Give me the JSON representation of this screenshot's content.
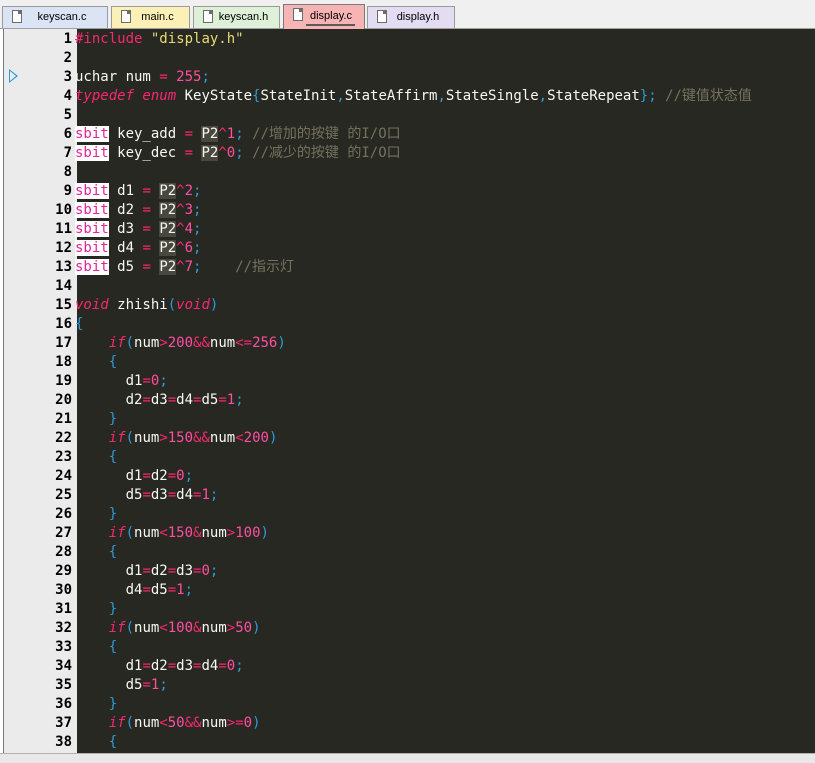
{
  "tabs": [
    {
      "label": "keyscan.c",
      "bg": "#dbe4f5"
    },
    {
      "label": "main.c",
      "bg": "#fbf0b6"
    },
    {
      "label": "keyscan.h",
      "bg": "#dff0d8"
    },
    {
      "label": "display.c",
      "bg": "#f7b4b4",
      "active": true
    },
    {
      "label": "display.h",
      "bg": "#e3dcf3"
    }
  ],
  "gutter": {
    "marker": "current-line-arrow"
  },
  "code_lines": [
    {
      "n": "1",
      "html": "<span class=\"k\">#include</span> <span class=\"s\">\"display.h\"</span>"
    },
    {
      "n": "2",
      "html": ""
    },
    {
      "n": "3",
      "html": "uchar num <span class=\"k\">=</span> <span class=\"n\">255</span><span class=\"p\">;</span>"
    },
    {
      "n": "4",
      "html": "<span class=\"ki\">typedef enum</span> KeyState<span class=\"p\">{</span>StateInit<span class=\"p\">,</span>StateAffirm<span class=\"p\">,</span>StateSingle<span class=\"p\">,</span>StateRepeat<span class=\"p\">};</span> <span class=\"c\">//键值状态值</span>"
    },
    {
      "n": "5",
      "html": ""
    },
    {
      "n": "6",
      "html": "<span class=\"kw\">sbit</span> key_add <span class=\"k\">=</span> <span class=\"hl\">P2</span><span class=\"k\">^</span><span class=\"n\">1</span><span class=\"p\">;</span> <span class=\"c\">//增加的按键 的I/O口</span>"
    },
    {
      "n": "7",
      "html": "<span class=\"kw\">sbit</span> key_dec <span class=\"k\">=</span> <span class=\"hl\">P2</span><span class=\"k\">^</span><span class=\"n\">0</span><span class=\"p\">;</span> <span class=\"c\">//减少的按键 的I/O口</span>"
    },
    {
      "n": "8",
      "html": ""
    },
    {
      "n": "9",
      "html": "<span class=\"kw\">sbit</span> d1 <span class=\"k\">=</span> <span class=\"hl\">P2</span><span class=\"k\">^</span><span class=\"n\">2</span><span class=\"p\">;</span>"
    },
    {
      "n": "10",
      "html": "<span class=\"kw\">sbit</span> d2 <span class=\"k\">=</span> <span class=\"hl\">P2</span><span class=\"k\">^</span><span class=\"n\">3</span><span class=\"p\">;</span>"
    },
    {
      "n": "11",
      "html": "<span class=\"kw\">sbit</span> d3 <span class=\"k\">=</span> <span class=\"hl\">P2</span><span class=\"k\">^</span><span class=\"n\">4</span><span class=\"p\">;</span>"
    },
    {
      "n": "12",
      "html": "<span class=\"kw\">sbit</span> d4 <span class=\"k\">=</span> <span class=\"hl\">P2</span><span class=\"k\">^</span><span class=\"n\">6</span><span class=\"p\">;</span>"
    },
    {
      "n": "13",
      "html": "<span class=\"kw\">sbit</span> d5 <span class=\"k\">=</span> <span class=\"hl\">P2</span><span class=\"k\">^</span><span class=\"n\">7</span><span class=\"p\">;</span>    <span class=\"c\">//指示灯</span>"
    },
    {
      "n": "14",
      "html": ""
    },
    {
      "n": "15",
      "html": "<span class=\"ki\">void</span> zhishi<span class=\"p\">(</span><span class=\"ki\">void</span><span class=\"p\">)</span>"
    },
    {
      "n": "16",
      "html": "<span class=\"p\">{</span>"
    },
    {
      "n": "17",
      "html": "    <span class=\"ki\">if</span><span class=\"p\">(</span>num<span class=\"k\">&gt;</span><span class=\"n\">200</span><span class=\"k\">&amp;&amp;</span>num<span class=\"k\">&lt;=</span><span class=\"n\">256</span><span class=\"p\">)</span>"
    },
    {
      "n": "18",
      "html": "    <span class=\"p\">{</span>"
    },
    {
      "n": "19",
      "html": "      d1<span class=\"k\">=</span><span class=\"n\">0</span><span class=\"p\">;</span>"
    },
    {
      "n": "20",
      "html": "      d2<span class=\"k\">=</span>d3<span class=\"k\">=</span>d4<span class=\"k\">=</span>d5<span class=\"k\">=</span><span class=\"n\">1</span><span class=\"p\">;</span>"
    },
    {
      "n": "21",
      "html": "    <span class=\"p\">}</span>"
    },
    {
      "n": "22",
      "html": "    <span class=\"ki\">if</span><span class=\"p\">(</span>num<span class=\"k\">&gt;</span><span class=\"n\">150</span><span class=\"k\">&amp;&amp;</span>num<span class=\"k\">&lt;</span><span class=\"n\">200</span><span class=\"p\">)</span>"
    },
    {
      "n": "23",
      "html": "    <span class=\"p\">{</span>"
    },
    {
      "n": "24",
      "html": "      d1<span class=\"k\">=</span>d2<span class=\"k\">=</span><span class=\"n\">0</span><span class=\"p\">;</span>"
    },
    {
      "n": "25",
      "html": "      d5<span class=\"k\">=</span>d3<span class=\"k\">=</span>d4<span class=\"k\">=</span><span class=\"n\">1</span><span class=\"p\">;</span>"
    },
    {
      "n": "26",
      "html": "    <span class=\"p\">}</span>"
    },
    {
      "n": "27",
      "html": "    <span class=\"ki\">if</span><span class=\"p\">(</span>num<span class=\"k\">&lt;</span><span class=\"n\">150</span><span class=\"k\">&amp;</span>num<span class=\"k\">&gt;</span><span class=\"n\">100</span><span class=\"p\">)</span>"
    },
    {
      "n": "28",
      "html": "    <span class=\"p\">{</span>"
    },
    {
      "n": "29",
      "html": "      d1<span class=\"k\">=</span>d2<span class=\"k\">=</span>d3<span class=\"k\">=</span><span class=\"n\">0</span><span class=\"p\">;</span>"
    },
    {
      "n": "30",
      "html": "      d4<span class=\"k\">=</span>d5<span class=\"k\">=</span><span class=\"n\">1</span><span class=\"p\">;</span>"
    },
    {
      "n": "31",
      "html": "    <span class=\"p\">}</span>"
    },
    {
      "n": "32",
      "html": "    <span class=\"ki\">if</span><span class=\"p\">(</span>num<span class=\"k\">&lt;</span><span class=\"n\">100</span><span class=\"k\">&amp;</span>num<span class=\"k\">&gt;</span><span class=\"n\">50</span><span class=\"p\">)</span>"
    },
    {
      "n": "33",
      "html": "    <span class=\"p\">{</span>"
    },
    {
      "n": "34",
      "html": "      d1<span class=\"k\">=</span>d2<span class=\"k\">=</span>d3<span class=\"k\">=</span>d4<span class=\"k\">=</span><span class=\"n\">0</span><span class=\"p\">;</span>"
    },
    {
      "n": "35",
      "html": "      d5<span class=\"k\">=</span><span class=\"n\">1</span><span class=\"p\">;</span>"
    },
    {
      "n": "36",
      "html": "    <span class=\"p\">}</span>"
    },
    {
      "n": "37",
      "html": "    <span class=\"ki\">if</span><span class=\"p\">(</span>num<span class=\"k\">&lt;</span><span class=\"n\">50</span><span class=\"k\">&amp;&amp;</span>num<span class=\"k\">&gt;=</span><span class=\"n\">0</span><span class=\"p\">)</span>"
    },
    {
      "n": "38",
      "html": "    <span class=\"p\">{</span>"
    }
  ],
  "colors": {
    "editor_bg": "#272822",
    "gutter_bg": "#ebebeb",
    "keyword": "#f92672",
    "string": "#e6db74",
    "number": "#ff4fa0",
    "comment": "#75715e",
    "punctuation": "#2e9bd6"
  }
}
